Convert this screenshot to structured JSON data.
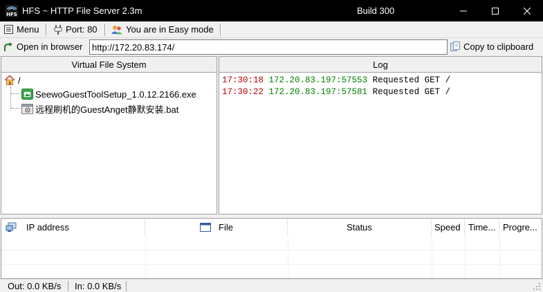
{
  "window": {
    "title": "HFS ~ HTTP File Server 2.3m",
    "build": "Build 300",
    "icon_text": "HFS"
  },
  "toolbar": {
    "menu_label": "Menu",
    "port_label": "Port: 80",
    "mode_label": "You are in Easy mode"
  },
  "address_bar": {
    "open_label": "Open in browser",
    "url_value": "http://172.20.83.174/",
    "copy_label": "Copy to clipboard"
  },
  "vfs": {
    "header": "Virtual File System",
    "root": "/",
    "items": [
      {
        "name": "SeewoGuestToolSetup_1.0.12.2166.exe",
        "icon": "exe-file-icon"
      },
      {
        "name": "远程刷机的GuestAnget静默安装.bat",
        "icon": "bat-file-icon"
      }
    ]
  },
  "log": {
    "header": "Log",
    "entries": [
      {
        "time": "17:30:18",
        "address": "172.20.83.197:57553",
        "message": "Requested GET /"
      },
      {
        "time": "17:30:22",
        "address": "172.20.83.197:57581",
        "message": "Requested GET /"
      }
    ]
  },
  "connections": {
    "columns": [
      "IP address",
      "File",
      "Status",
      "Speed",
      "Time...",
      "Progre..."
    ]
  },
  "status": {
    "out": "Out: 0.0 KB/s",
    "in": "In: 0.0 KB/s"
  },
  "colors": {
    "log_time": "#c00000",
    "log_address": "#008000",
    "titlebar": "#000000"
  }
}
